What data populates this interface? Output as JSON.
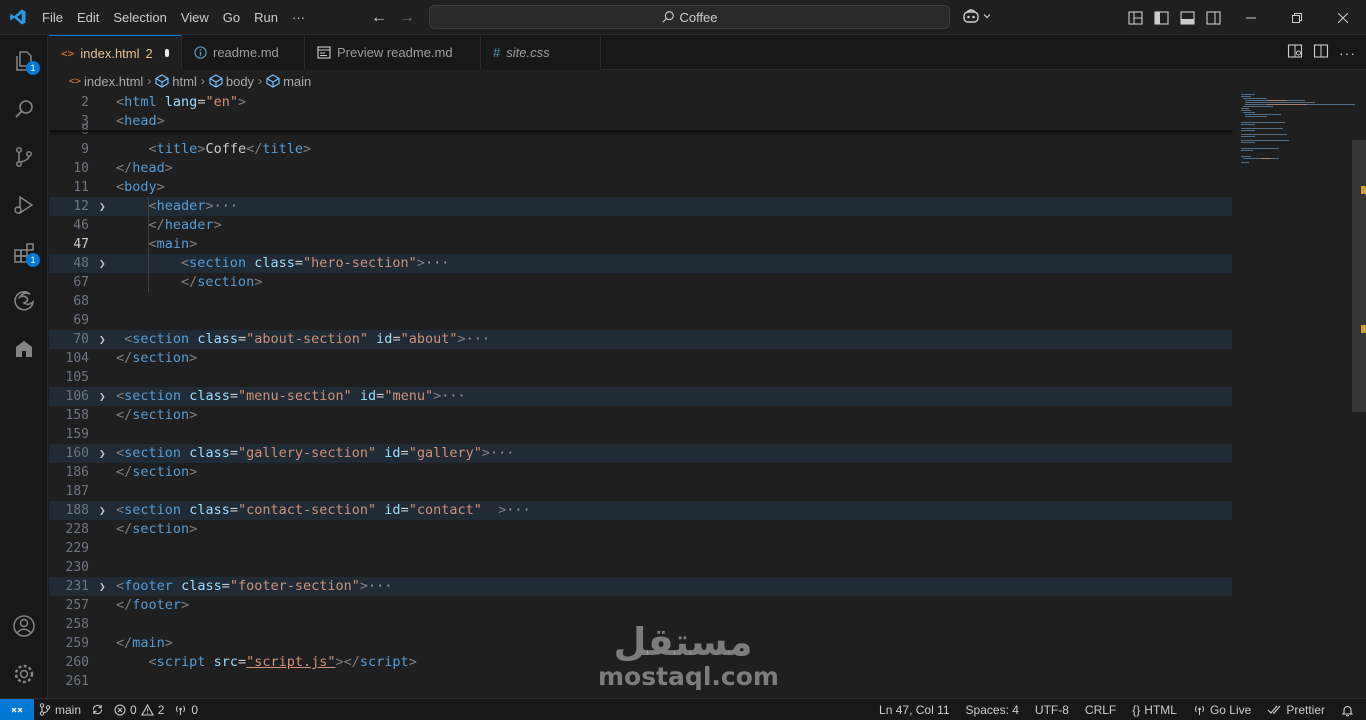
{
  "titlebar": {
    "menu": [
      "File",
      "Edit",
      "Selection",
      "View",
      "Go",
      "Run",
      "···"
    ],
    "search_text": "Coffee"
  },
  "activity": {
    "explorer_badge": "1",
    "extensions_badge": "1"
  },
  "tabs": [
    {
      "label": "index.html",
      "suffix": "2",
      "active": true
    },
    {
      "label": "readme.md"
    },
    {
      "label": "Preview readme.md"
    },
    {
      "label": "site.css"
    }
  ],
  "breadcrumb": [
    "index.html",
    "html",
    "body",
    "main"
  ],
  "editor": {
    "lines": [
      {
        "n": "2",
        "code": [
          [
            "br",
            "<"
          ],
          [
            "tag",
            "html"
          ],
          [
            "txt",
            " "
          ],
          [
            "attr",
            "lang"
          ],
          [
            "txt",
            "="
          ],
          [
            "str",
            "\"en\""
          ],
          [
            "br",
            ">"
          ]
        ]
      },
      {
        "n": "3",
        "code": [
          [
            "br",
            "<"
          ],
          [
            "tag",
            "head"
          ],
          [
            "br",
            ">"
          ]
        ]
      },
      {
        "n": "8",
        "code": []
      },
      {
        "n": "9",
        "code": [
          [
            "txt",
            "    "
          ],
          [
            "br",
            "<"
          ],
          [
            "tag",
            "title"
          ],
          [
            "br",
            ">"
          ],
          [
            "txt",
            "Coffe"
          ],
          [
            "br",
            "</"
          ],
          [
            "tag",
            "title"
          ],
          [
            "br",
            ">"
          ]
        ]
      },
      {
        "n": "10",
        "code": [
          [
            "br",
            "</"
          ],
          [
            "tag",
            "head"
          ],
          [
            "br",
            ">"
          ]
        ]
      },
      {
        "n": "11",
        "code": [
          [
            "br",
            "<"
          ],
          [
            "tag",
            "body"
          ],
          [
            "br",
            ">"
          ]
        ]
      },
      {
        "n": "12",
        "fold": true,
        "code": [
          [
            "txt",
            "    "
          ],
          [
            "br",
            "<"
          ],
          [
            "tag",
            "header"
          ],
          [
            "br",
            ">"
          ],
          [
            "ell",
            "···"
          ]
        ]
      },
      {
        "n": "46",
        "code": [
          [
            "txt",
            "    "
          ],
          [
            "br",
            "</"
          ],
          [
            "tag",
            "header"
          ],
          [
            "br",
            ">"
          ]
        ]
      },
      {
        "n": "47",
        "current": true,
        "code": [
          [
            "txt",
            "    "
          ],
          [
            "br",
            "<"
          ],
          [
            "tag",
            "main"
          ],
          [
            "br",
            ">"
          ]
        ]
      },
      {
        "n": "48",
        "fold": true,
        "code": [
          [
            "txt",
            "        "
          ],
          [
            "br",
            "<"
          ],
          [
            "tag",
            "section"
          ],
          [
            "txt",
            " "
          ],
          [
            "attr",
            "class"
          ],
          [
            "txt",
            "="
          ],
          [
            "str",
            "\"hero-section\""
          ],
          [
            "br",
            ">"
          ],
          [
            "ell",
            "···"
          ]
        ]
      },
      {
        "n": "67",
        "code": [
          [
            "txt",
            "        "
          ],
          [
            "br",
            "</"
          ],
          [
            "tag",
            "section"
          ],
          [
            "br",
            ">"
          ]
        ]
      },
      {
        "n": "68",
        "code": []
      },
      {
        "n": "69",
        "code": []
      },
      {
        "n": "70",
        "fold": true,
        "code": [
          [
            "txt",
            " "
          ],
          [
            "br",
            "<"
          ],
          [
            "tag",
            "section"
          ],
          [
            "txt",
            " "
          ],
          [
            "attr",
            "class"
          ],
          [
            "txt",
            "="
          ],
          [
            "str",
            "\"about-section\""
          ],
          [
            "txt",
            " "
          ],
          [
            "attr",
            "id"
          ],
          [
            "txt",
            "="
          ],
          [
            "str",
            "\"about\""
          ],
          [
            "br",
            ">"
          ],
          [
            "ell",
            "···"
          ]
        ]
      },
      {
        "n": "104",
        "code": [
          [
            "br",
            "</"
          ],
          [
            "tag",
            "section"
          ],
          [
            "br",
            ">"
          ]
        ]
      },
      {
        "n": "105",
        "code": []
      },
      {
        "n": "106",
        "fold": true,
        "code": [
          [
            "br",
            "<"
          ],
          [
            "tag",
            "section"
          ],
          [
            "txt",
            " "
          ],
          [
            "attr",
            "class"
          ],
          [
            "txt",
            "="
          ],
          [
            "str",
            "\"menu-section\""
          ],
          [
            "txt",
            " "
          ],
          [
            "attr",
            "id"
          ],
          [
            "txt",
            "="
          ],
          [
            "str",
            "\"menu\""
          ],
          [
            "br",
            ">"
          ],
          [
            "ell",
            "···"
          ]
        ]
      },
      {
        "n": "158",
        "code": [
          [
            "br",
            "</"
          ],
          [
            "tag",
            "section"
          ],
          [
            "br",
            ">"
          ]
        ]
      },
      {
        "n": "159",
        "code": []
      },
      {
        "n": "160",
        "fold": true,
        "code": [
          [
            "br",
            "<"
          ],
          [
            "tag",
            "section"
          ],
          [
            "txt",
            " "
          ],
          [
            "attr",
            "class"
          ],
          [
            "txt",
            "="
          ],
          [
            "str",
            "\"gallery-section\""
          ],
          [
            "txt",
            " "
          ],
          [
            "attr",
            "id"
          ],
          [
            "txt",
            "="
          ],
          [
            "str",
            "\"gallery\""
          ],
          [
            "br",
            ">"
          ],
          [
            "ell",
            "···"
          ]
        ]
      },
      {
        "n": "186",
        "code": [
          [
            "br",
            "</"
          ],
          [
            "tag",
            "section"
          ],
          [
            "br",
            ">"
          ]
        ]
      },
      {
        "n": "187",
        "code": []
      },
      {
        "n": "188",
        "fold": true,
        "code": [
          [
            "br",
            "<"
          ],
          [
            "tag",
            "section"
          ],
          [
            "txt",
            " "
          ],
          [
            "attr",
            "class"
          ],
          [
            "txt",
            "="
          ],
          [
            "str",
            "\"contact-section\""
          ],
          [
            "txt",
            " "
          ],
          [
            "attr",
            "id"
          ],
          [
            "txt",
            "="
          ],
          [
            "str",
            "\"contact\""
          ],
          [
            "txt",
            "  "
          ],
          [
            "br",
            ">"
          ],
          [
            "ell",
            "···"
          ]
        ]
      },
      {
        "n": "228",
        "code": [
          [
            "br",
            "</"
          ],
          [
            "tag",
            "section"
          ],
          [
            "br",
            ">"
          ]
        ]
      },
      {
        "n": "229",
        "code": []
      },
      {
        "n": "230",
        "code": []
      },
      {
        "n": "231",
        "fold": true,
        "code": [
          [
            "br",
            "<"
          ],
          [
            "tag",
            "footer"
          ],
          [
            "txt",
            " "
          ],
          [
            "attr",
            "class"
          ],
          [
            "txt",
            "="
          ],
          [
            "str",
            "\"footer-section\""
          ],
          [
            "br",
            ">"
          ],
          [
            "ell",
            "···"
          ]
        ]
      },
      {
        "n": "257",
        "code": [
          [
            "br",
            "</"
          ],
          [
            "tag",
            "footer"
          ],
          [
            "br",
            ">"
          ]
        ]
      },
      {
        "n": "258",
        "code": []
      },
      {
        "n": "259",
        "code": [
          [
            "br",
            "</"
          ],
          [
            "tag",
            "main"
          ],
          [
            "br",
            ">"
          ]
        ]
      },
      {
        "n": "260",
        "code": [
          [
            "txt",
            "    "
          ],
          [
            "br",
            "<"
          ],
          [
            "tag",
            "script"
          ],
          [
            "txt",
            " "
          ],
          [
            "attr",
            "src"
          ],
          [
            "txt",
            "="
          ],
          [
            "str",
            "\"script.js\""
          ],
          [
            "br",
            "></"
          ],
          [
            "tag",
            "script"
          ],
          [
            "br",
            ">"
          ]
        ]
      },
      {
        "n": "261",
        "code": []
      }
    ]
  },
  "watermark": {
    "arabic": "مستقل",
    "latin": "mostaql.com"
  },
  "status": {
    "branch": "main",
    "errors": "0",
    "warnings": "2",
    "ports": "0",
    "cursor": "Ln 47, Col 11",
    "spaces": "Spaces: 4",
    "encoding": "UTF-8",
    "eol": "CRLF",
    "language": "HTML",
    "golive": "Go Live",
    "prettier": "Prettier"
  },
  "colors": {
    "accent": "#0078d4",
    "modified": "#e2c08d",
    "tag": "#569cd6",
    "attr": "#9cdcfe",
    "string": "#ce9178"
  }
}
